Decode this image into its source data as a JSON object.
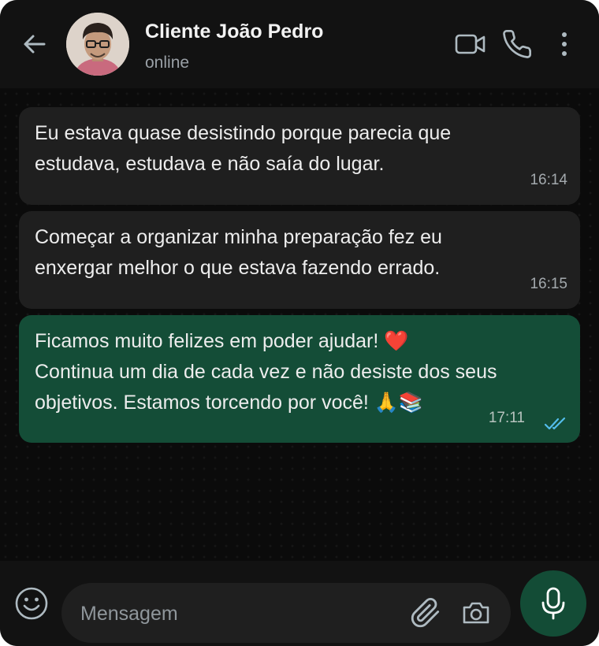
{
  "contact": {
    "name": "Cliente João Pedro",
    "status": "online"
  },
  "messages": [
    {
      "direction": "incoming",
      "text": "Eu estava quase desistindo porque parecia que\nestudava, estudava e não saía do lugar.",
      "time": "16:14"
    },
    {
      "direction": "incoming",
      "text": "Começar a organizar minha preparação fez eu\nenxergar melhor o que estava fazendo errado.",
      "time": "16:15"
    },
    {
      "direction": "outgoing",
      "text": "Ficamos muito felizes em poder ajudar! ❤️\nContinua um dia de cada vez e não desiste dos seus\nobjetivos. Estamos torcendo por você! 🙏📚",
      "time": "17:11",
      "status": "read"
    }
  ],
  "composer": {
    "placeholder": "Mensagem"
  },
  "icons": {
    "back": "arrow-left-icon",
    "video": "video-camera-icon",
    "call": "phone-icon",
    "menu": "more-vertical-icon",
    "emoji": "emoji-icon",
    "attach": "paperclip-icon",
    "camera": "camera-icon",
    "mic": "microphone-icon",
    "read_receipt": "double-check-icon"
  },
  "colors": {
    "background": "#0b0b0b",
    "bar": "#121212",
    "incoming_bubble": "#1f1f1f",
    "outgoing_bubble": "#144d37",
    "accent_green": "#134c36",
    "read_tick": "#53bdeb",
    "icon": "#aebac1"
  }
}
